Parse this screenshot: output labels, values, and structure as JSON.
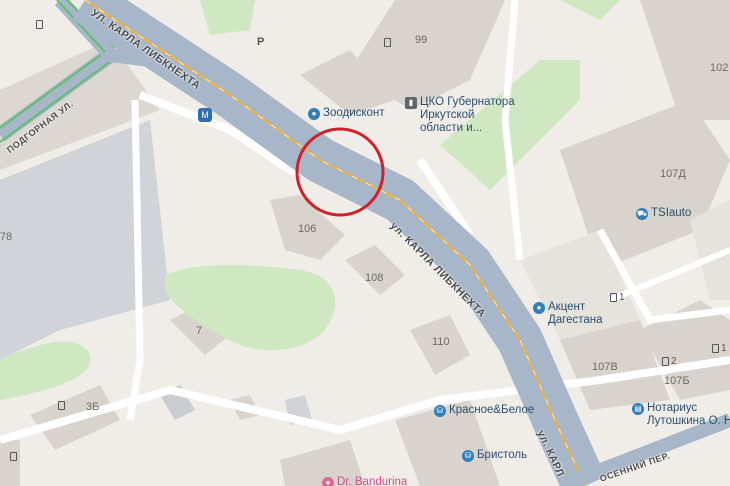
{
  "map": {
    "marker_color": "#d0202a",
    "road_color": "#a7b6c9",
    "road_center_color": "#f2b233",
    "building_color": "#d8d3cc",
    "building_light_color": "#e6e2dc",
    "park_color": "#cfe8c1",
    "tram_color": "#5fbf6b",
    "poi_color": "#2f7fb8"
  },
  "streets": {
    "karla_top": "УЛ. КАРЛА ЛИБКНЕХТА",
    "karla_middle": "ул. КАРЛА ЛИБКНЕХТА",
    "karla_bottom": "ул. КАРЛ",
    "podgornaya": "ПОДГОРНАЯ УЛ.",
    "osenniy": "ОСЕННИЙ ПЕР."
  },
  "houses": {
    "h99": "99",
    "h102": "102",
    "h107d": "107Д",
    "h106": "106",
    "h108": "108",
    "h7": "7",
    "h110": "110",
    "h3b": "3Б",
    "h107v": "107В",
    "h107b": "107Б",
    "h78": "78"
  },
  "pois": {
    "zoodiskont": "Зоодисконт",
    "cko_line1": "ЦКО Губернатора",
    "cko_line2": "Иркутской",
    "cko_line3": "области и...",
    "tsiauto": "TSIauto",
    "akcent_line1": "Акцент",
    "akcent_line2": "Дагестана",
    "krasnoe": "Красное&Белое",
    "bristol": "Бристоль",
    "notarius_line1": "Нотариус",
    "notarius_line2": "Лутошкина О. Н.",
    "dr_bandurina": "Dr. Bandurina"
  },
  "entrances": {
    "e1": "1",
    "e2": "2",
    "e3": "1"
  },
  "parking": "P",
  "metro_symbol": "М"
}
